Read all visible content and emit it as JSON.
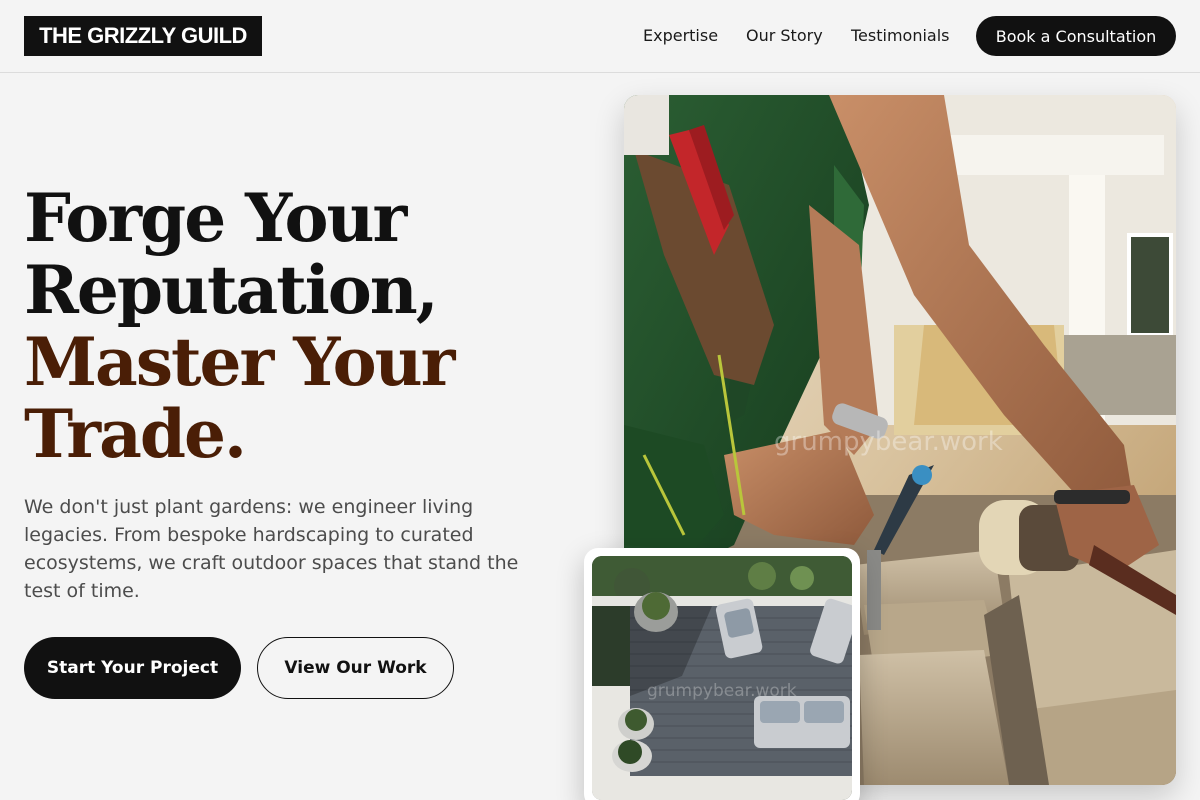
{
  "header": {
    "logo": "THE GRIZZLY GUILD",
    "nav": [
      "Expertise",
      "Our Story",
      "Testimonials"
    ],
    "cta": "Book a Consultation"
  },
  "hero": {
    "headline_dark": [
      "Forge Your",
      "Reputation,"
    ],
    "headline_accent": [
      "Master Your",
      "Trade."
    ],
    "lead": "We don't just plant gardens: we engineer living legacies. From bespoke hardscaping to curated ecosystems, we craft outdoor spaces that stand the test of time.",
    "primary_button": "Start Your Project",
    "secondary_button": "View Our Work"
  },
  "images": {
    "main_watermark": "grumpybear.work",
    "thumb_watermark": "grumpybear.work"
  },
  "colors": {
    "accent": "#4a1e06",
    "button_dark": "#111111",
    "background": "#f4f4f4"
  }
}
